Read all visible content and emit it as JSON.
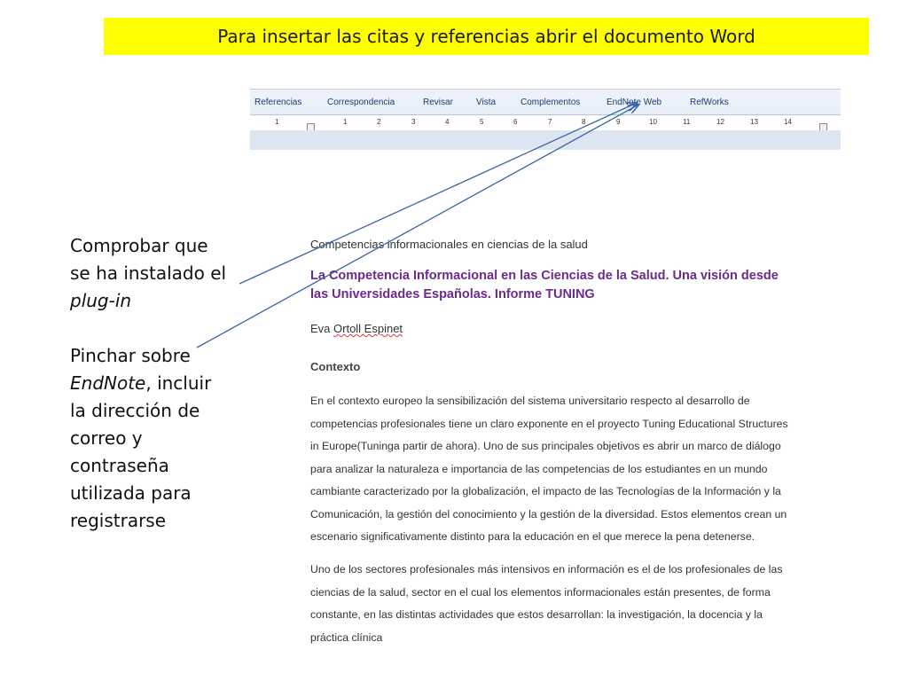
{
  "banner": {
    "text": "Para insertar las citas y referencias abrir el documento Word"
  },
  "ribbon": {
    "tabs": [
      "Referencias",
      "Correspondencia",
      "Revisar",
      "Vista",
      "Complementos",
      "EndNote Web",
      "RefWorks"
    ],
    "ruler_labels": [
      "1",
      "1",
      "2",
      "3",
      "4",
      "5",
      "6",
      "7",
      "8",
      "9",
      "10",
      "11",
      "12",
      "13",
      "14"
    ]
  },
  "instructions": {
    "line1a": "Comprobar que",
    "line1b": "se ha instalado el",
    "line1c": "plug-in",
    "line2a": "Pinchar sobre",
    "line2b_em": "EndNote",
    "line2b": ", incluir",
    "line2c": "la dirección de",
    "line2d": "correo y",
    "line2e": "contraseña",
    "line2f": "utilizada para",
    "line2g": "registrarse"
  },
  "document": {
    "header": "Competencias informacionales en ciencias de la salud",
    "title_line1": "La Competencia  Informacional en las Ciencias de la Salud. Una visión desde",
    "title_line2": "las Universidades  Españolas.  Informe TUNING",
    "author_first": "Eva ",
    "author_last": "Ortoll Espinet",
    "section": "Contexto",
    "p1": [
      "En el contexto europeo la sensibilización del sistema universitario respecto al desarrollo de",
      "competencias profesionales tiene un claro exponente en el proyecto Tuning Educational Structures",
      "in Europe(Tuninga partir de ahora). Uno de sus principales objetivos es abrir un marco de diálogo",
      "para analizar  la naturaleza e importancia  de las competencias de los estudiantes en un mundo",
      "cambiante caracterizado por la globalización,  el impacto de las Tecnologías de la Información y la",
      "Comunicación, la gestión del conocimiento y la gestión de la diversidad. Estos elementos crean un",
      "escenario significativamente distinto para la educación en el que merece la pena detenerse."
    ],
    "p2": [
      "Uno de los sectores profesionales más intensivos en información es el de los profesionales de las",
      "ciencias de la salud, sector en el cual los elementos informacionales están presentes, de forma",
      "constante, en las distintas actividades que estos desarrollan: la investigación, la docencia y la",
      "práctica clínica"
    ]
  },
  "colors": {
    "banner_bg": "#ffff00",
    "title": "#6c2a8c",
    "arrow": "#3a64a8"
  }
}
